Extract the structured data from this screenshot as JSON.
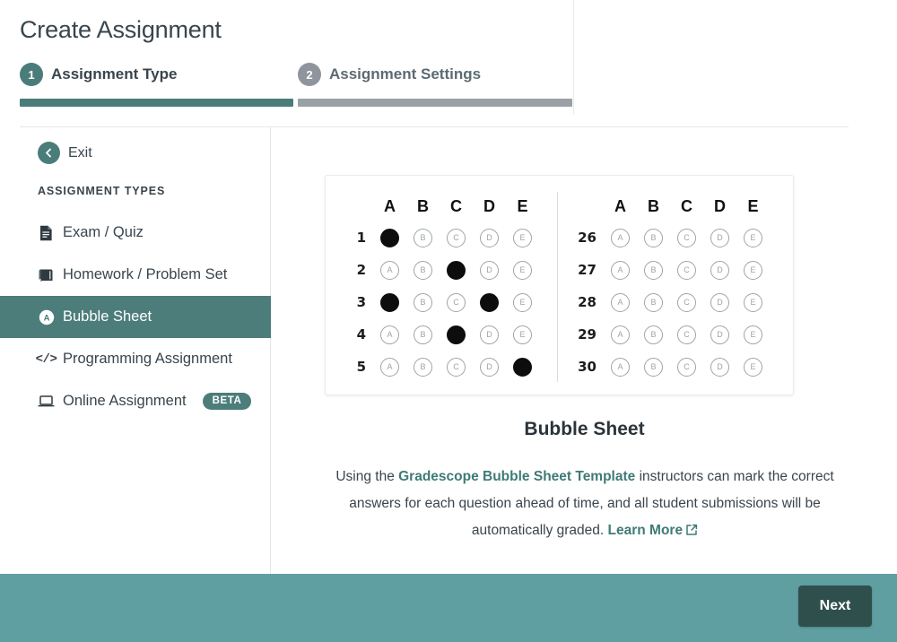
{
  "header": {
    "title": "Create Assignment",
    "steps": [
      {
        "number": "1",
        "label": "Assignment Type",
        "state": "active"
      },
      {
        "number": "2",
        "label": "Assignment Settings",
        "state": "inactive"
      }
    ]
  },
  "sidebar": {
    "exit_label": "Exit",
    "section_title": "ASSIGNMENT TYPES",
    "items": [
      {
        "label": "Exam / Quiz",
        "icon": "document-icon",
        "selected": false,
        "badge": ""
      },
      {
        "label": "Homework / Problem Set",
        "icon": "book-icon",
        "selected": false,
        "badge": ""
      },
      {
        "label": "Bubble Sheet",
        "icon": "bubble-a-icon",
        "selected": true,
        "badge": ""
      },
      {
        "label": "Programming Assignment",
        "icon": "code-icon",
        "selected": false,
        "badge": ""
      },
      {
        "label": "Online Assignment",
        "icon": "laptop-icon",
        "selected": false,
        "badge": "BETA"
      }
    ]
  },
  "main": {
    "preview": {
      "columns": [
        "A",
        "B",
        "C",
        "D",
        "E"
      ],
      "left_block": [
        {
          "number": "1",
          "answers": [
            "A",
            "B",
            "C",
            "D",
            "E"
          ],
          "marked": "A"
        },
        {
          "number": "2",
          "answers": [
            "A",
            "B",
            "C",
            "D",
            "E"
          ],
          "marked": "C"
        },
        {
          "number": "3",
          "answers": [
            "A",
            "B",
            "C",
            "D",
            "E"
          ],
          "marked": "A,D"
        },
        {
          "number": "4",
          "answers": [
            "A",
            "B",
            "C",
            "D",
            "E"
          ],
          "marked": "C"
        },
        {
          "number": "5",
          "answers": [
            "A",
            "B",
            "C",
            "D",
            "E"
          ],
          "marked": "E"
        }
      ],
      "right_block": [
        {
          "number": "26",
          "answers": [
            "A",
            "B",
            "C",
            "D",
            "E"
          ],
          "marked": ""
        },
        {
          "number": "27",
          "answers": [
            "A",
            "B",
            "C",
            "D",
            "E"
          ],
          "marked": ""
        },
        {
          "number": "28",
          "answers": [
            "A",
            "B",
            "C",
            "D",
            "E"
          ],
          "marked": ""
        },
        {
          "number": "29",
          "answers": [
            "A",
            "B",
            "C",
            "D",
            "E"
          ],
          "marked": ""
        },
        {
          "number": "30",
          "answers": [
            "A",
            "B",
            "C",
            "D",
            "E"
          ],
          "marked": ""
        }
      ]
    },
    "title": "Bubble Sheet",
    "description": {
      "part1": "Using the ",
      "link1": "Gradescope Bubble Sheet Template",
      "part2": " instructors can mark the correct answers for each question ahead of time, and all student submissions will be automatically graded. ",
      "link2": "Learn More"
    }
  },
  "footer": {
    "next_label": "Next"
  },
  "colors": {
    "accent_teal": "#4a7c7a",
    "selected_item": "#4c7d7b",
    "footer_bar": "#5f9fa1",
    "next_button": "#2f4f4c",
    "inactive_gray": "#8e959c",
    "step_bar_inactive": "#9aa0a6",
    "link_teal": "#3f7a76",
    "bubble_outline": "#9fa4a8",
    "bubble_filled": "#0d0d0d"
  }
}
